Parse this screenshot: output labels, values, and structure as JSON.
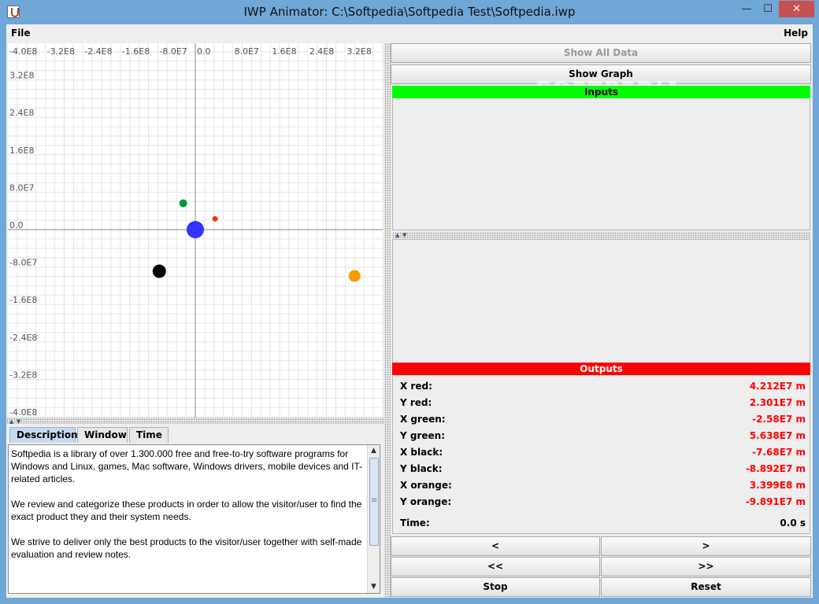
{
  "window": {
    "title": "IWP Animator: C:\\Softpedia\\Softpedia Test\\Softpedia.iwp",
    "controls": {
      "minimize": "—",
      "maximize": "☐",
      "close": "✕"
    }
  },
  "menubar": {
    "file": "File",
    "help": "Help"
  },
  "plot": {
    "x_ticks": [
      "-4.0E8",
      "-3.2E8",
      "-2.4E8",
      "-1.6E8",
      "-8.0E7",
      "0.0",
      "8.0E7",
      "1.6E8",
      "2.4E8",
      "3.2E8"
    ],
    "y_ticks": [
      "3.2E8",
      "2.4E8",
      "1.6E8",
      "8.0E7",
      "0.0",
      "-8.0E7",
      "-1.6E8",
      "-2.4E8",
      "-3.2E8",
      "-4.0E8"
    ],
    "x_range": [
      -400000000.0,
      400000000.0
    ],
    "y_range": [
      -400000000.0,
      400000000.0
    ],
    "bodies": [
      {
        "name": "blue",
        "x": 0,
        "y": 0,
        "color": "#3333ff"
      },
      {
        "name": "red",
        "x": 42120000.0,
        "y": 23010000.0,
        "color": "#ff3300"
      },
      {
        "name": "green",
        "x": -25800000.0,
        "y": 56380000.0,
        "color": "#009933"
      },
      {
        "name": "black",
        "x": -76800000.0,
        "y": -88920000.0,
        "color": "#000000"
      },
      {
        "name": "orange",
        "x": 339900000.0,
        "y": -98910000.0,
        "color": "#ff9900"
      }
    ],
    "grid": true
  },
  "tabs": [
    "Description",
    "Window",
    "Time"
  ],
  "description": "Softpedia is a library of over 1.300.000 free and free-to-try software programs for Windows and Linux, games, Mac software, Windows drivers, mobile devices and IT-related articles.\n\nWe review and categorize these products in order to allow the visitor/user to find the exact product they and their system needs.\n\nWe strive to deliver only the best products to the visitor/user together with self-made evaluation and review notes.",
  "buttons": {
    "show_all_data": "Show All Data",
    "show_graph": "Show Graph",
    "step_back": "<",
    "step_forward": ">",
    "fast_back": "<<",
    "fast_forward": ">>",
    "stop": "Stop",
    "reset": "Reset"
  },
  "watermark": "SOFTPEDIA",
  "inputs_header": "Inputs",
  "outputs_header": "Outputs",
  "outputs": [
    {
      "label": "X red:",
      "value": "4.212E7 m"
    },
    {
      "label": "Y red:",
      "value": "2.301E7 m"
    },
    {
      "label": "X green:",
      "value": "-2.58E7 m"
    },
    {
      "label": "Y green:",
      "value": "5.638E7 m"
    },
    {
      "label": "X black:",
      "value": "-7.68E7 m"
    },
    {
      "label": "Y black:",
      "value": "-8.892E7 m"
    },
    {
      "label": "X orange:",
      "value": "3.399E8 m"
    },
    {
      "label": "Y orange:",
      "value": "-9.891E7 m"
    }
  ],
  "time": {
    "label": "Time:",
    "value": "0.0 s"
  },
  "colors": {
    "inputs_bg": "#00ff00",
    "outputs_bg": "#ff0000",
    "value_color": "#ff0000"
  }
}
